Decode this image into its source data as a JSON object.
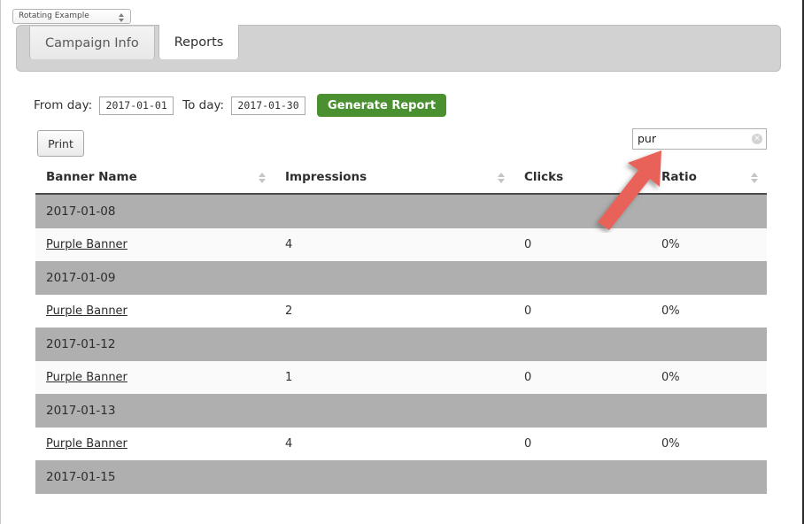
{
  "campaign_selector": {
    "value": "Rotating Example",
    "icon": "stepper-updown-icon"
  },
  "tabs": [
    {
      "label": "Campaign Info",
      "active": false
    },
    {
      "label": "Reports",
      "active": true
    }
  ],
  "filters": {
    "from_label": "From day:",
    "from_value": "2017-01-01",
    "to_label": "To day:",
    "to_value": "2017-01-30",
    "generate_label": "Generate Report",
    "generate_color": "#4b9030"
  },
  "actions": {
    "print_label": "Print"
  },
  "search": {
    "value": "pur",
    "placeholder": "",
    "clear_icon": "clear-circle-icon",
    "clear_glyph": "✕"
  },
  "table": {
    "columns": [
      {
        "label": "Banner Name",
        "sortable": true
      },
      {
        "label": "Impressions",
        "sortable": true
      },
      {
        "label": "Clicks",
        "sortable": true
      },
      {
        "label": "Ratio",
        "sortable": true
      }
    ],
    "rows": [
      {
        "type": "group",
        "date": "2017-01-08"
      },
      {
        "type": "data",
        "banner": "Purple Banner",
        "impressions": "4",
        "clicks": "0",
        "ratio": "0%"
      },
      {
        "type": "group",
        "date": "2017-01-09"
      },
      {
        "type": "data",
        "banner": "Purple Banner",
        "impressions": "2",
        "clicks": "0",
        "ratio": "0%"
      },
      {
        "type": "group",
        "date": "2017-01-12"
      },
      {
        "type": "data",
        "banner": "Purple Banner",
        "impressions": "1",
        "clicks": "0",
        "ratio": "0%"
      },
      {
        "type": "group",
        "date": "2017-01-13"
      },
      {
        "type": "data",
        "banner": "Purple Banner",
        "impressions": "4",
        "clicks": "0",
        "ratio": "0%"
      },
      {
        "type": "group",
        "date": "2017-01-15"
      }
    ]
  },
  "annotation": {
    "type": "arrow",
    "color": "#e8625a",
    "points_to": "search-input",
    "direction": "up-right"
  }
}
